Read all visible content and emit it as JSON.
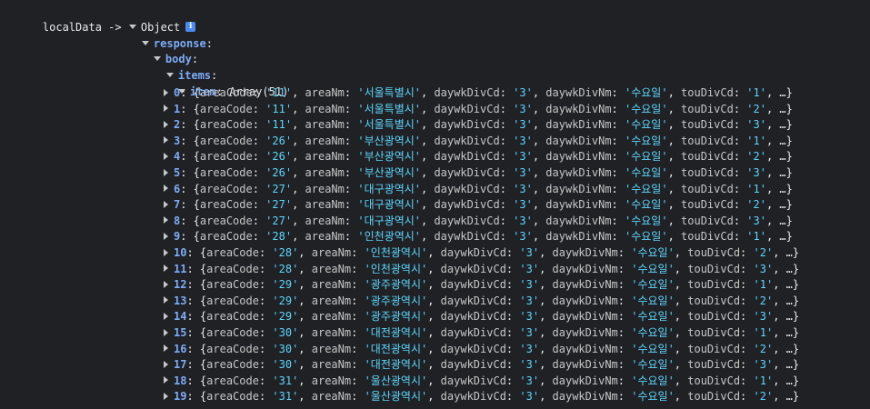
{
  "header": {
    "label": "localData ->",
    "type": "Object",
    "info_icon": "i"
  },
  "tree": {
    "response": "response",
    "body": "body",
    "items": "items",
    "item": "item",
    "item_type": "Array(51)"
  },
  "rows": [
    {
      "index": "0",
      "areaCode": "'11'",
      "areaNm": "'서울특별시'",
      "daywkDivCd": "'3'",
      "daywkDivNm": "'수요일'",
      "touDivCd": "'1'"
    },
    {
      "index": "1",
      "areaCode": "'11'",
      "areaNm": "'서울특별시'",
      "daywkDivCd": "'3'",
      "daywkDivNm": "'수요일'",
      "touDivCd": "'2'"
    },
    {
      "index": "2",
      "areaCode": "'11'",
      "areaNm": "'서울특별시'",
      "daywkDivCd": "'3'",
      "daywkDivNm": "'수요일'",
      "touDivCd": "'3'"
    },
    {
      "index": "3",
      "areaCode": "'26'",
      "areaNm": "'부산광역시'",
      "daywkDivCd": "'3'",
      "daywkDivNm": "'수요일'",
      "touDivCd": "'1'"
    },
    {
      "index": "4",
      "areaCode": "'26'",
      "areaNm": "'부산광역시'",
      "daywkDivCd": "'3'",
      "daywkDivNm": "'수요일'",
      "touDivCd": "'2'"
    },
    {
      "index": "5",
      "areaCode": "'26'",
      "areaNm": "'부산광역시'",
      "daywkDivCd": "'3'",
      "daywkDivNm": "'수요일'",
      "touDivCd": "'3'"
    },
    {
      "index": "6",
      "areaCode": "'27'",
      "areaNm": "'대구광역시'",
      "daywkDivCd": "'3'",
      "daywkDivNm": "'수요일'",
      "touDivCd": "'1'"
    },
    {
      "index": "7",
      "areaCode": "'27'",
      "areaNm": "'대구광역시'",
      "daywkDivCd": "'3'",
      "daywkDivNm": "'수요일'",
      "touDivCd": "'2'"
    },
    {
      "index": "8",
      "areaCode": "'27'",
      "areaNm": "'대구광역시'",
      "daywkDivCd": "'3'",
      "daywkDivNm": "'수요일'",
      "touDivCd": "'3'"
    },
    {
      "index": "9",
      "areaCode": "'28'",
      "areaNm": "'인천광역시'",
      "daywkDivCd": "'3'",
      "daywkDivNm": "'수요일'",
      "touDivCd": "'1'"
    },
    {
      "index": "10",
      "areaCode": "'28'",
      "areaNm": "'인천광역시'",
      "daywkDivCd": "'3'",
      "daywkDivNm": "'수요일'",
      "touDivCd": "'2'"
    },
    {
      "index": "11",
      "areaCode": "'28'",
      "areaNm": "'인천광역시'",
      "daywkDivCd": "'3'",
      "daywkDivNm": "'수요일'",
      "touDivCd": "'3'"
    },
    {
      "index": "12",
      "areaCode": "'29'",
      "areaNm": "'광주광역시'",
      "daywkDivCd": "'3'",
      "daywkDivNm": "'수요일'",
      "touDivCd": "'1'"
    },
    {
      "index": "13",
      "areaCode": "'29'",
      "areaNm": "'광주광역시'",
      "daywkDivCd": "'3'",
      "daywkDivNm": "'수요일'",
      "touDivCd": "'2'"
    },
    {
      "index": "14",
      "areaCode": "'29'",
      "areaNm": "'광주광역시'",
      "daywkDivCd": "'3'",
      "daywkDivNm": "'수요일'",
      "touDivCd": "'3'"
    },
    {
      "index": "15",
      "areaCode": "'30'",
      "areaNm": "'대전광역시'",
      "daywkDivCd": "'3'",
      "daywkDivNm": "'수요일'",
      "touDivCd": "'1'"
    },
    {
      "index": "16",
      "areaCode": "'30'",
      "areaNm": "'대전광역시'",
      "daywkDivCd": "'3'",
      "daywkDivNm": "'수요일'",
      "touDivCd": "'2'"
    },
    {
      "index": "17",
      "areaCode": "'30'",
      "areaNm": "'대전광역시'",
      "daywkDivCd": "'3'",
      "daywkDivNm": "'수요일'",
      "touDivCd": "'3'"
    },
    {
      "index": "18",
      "areaCode": "'31'",
      "areaNm": "'울산광역시'",
      "daywkDivCd": "'3'",
      "daywkDivNm": "'수요일'",
      "touDivCd": "'1'"
    },
    {
      "index": "19",
      "areaCode": "'31'",
      "areaNm": "'울산광역시'",
      "daywkDivCd": "'3'",
      "daywkDivNm": "'수요일'",
      "touDivCd": "'2'"
    }
  ],
  "labels": {
    "areaCode": "areaCode",
    "areaNm": "areaNm",
    "daywkDivCd": "daywkDivCd",
    "daywkDivNm": "daywkDivNm",
    "touDivCd": "touDivCd",
    "ellipsis": "…"
  },
  "colors": {
    "background": "#202124",
    "key": "#7cacf8",
    "string": "#5cd5fb",
    "text": "#e8eaed"
  }
}
